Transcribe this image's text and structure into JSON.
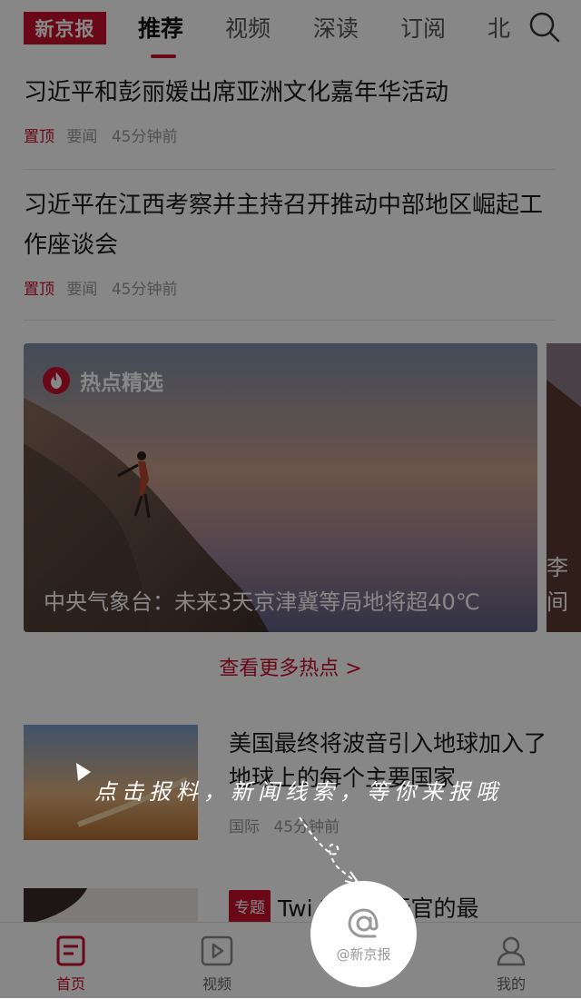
{
  "header": {
    "logo_text": "新京报",
    "tabs": [
      {
        "label": "推荐",
        "active": true
      },
      {
        "label": "视频"
      },
      {
        "label": "深读"
      },
      {
        "label": "订阅"
      },
      {
        "label": "北"
      }
    ]
  },
  "news": [
    {
      "title": "习近平和彭丽媛出席亚洲文化嘉年华活动",
      "pin": "置顶",
      "category": "要闻",
      "time": "45分钟前"
    },
    {
      "title": "习近平在江西考察并主持召开推动中部地区崛起工作座谈会",
      "pin": "置顶",
      "category": "要闻",
      "time": "45分钟前"
    }
  ],
  "featured": {
    "badge": "热点精选",
    "caption": "中央气象台：未来3天京津冀等局地将超40℃",
    "peek_caption": "李间"
  },
  "more_link": "查看更多热点 >",
  "article_3": {
    "title": "美国最终将波音引入地球加入了地球上的每个主要国家",
    "category": "国际",
    "time": "45分钟前"
  },
  "article_4": {
    "tag": "专题",
    "title": "Twi 首席执行官的最"
  },
  "bottom_nav": {
    "home": "首页",
    "video": "视频",
    "mine": "我的"
  },
  "overlay": {
    "hint": "点击报料，新闻线索，等你来报哦",
    "report_label": "@新京报"
  },
  "colors": {
    "brand": "#c8102e"
  }
}
